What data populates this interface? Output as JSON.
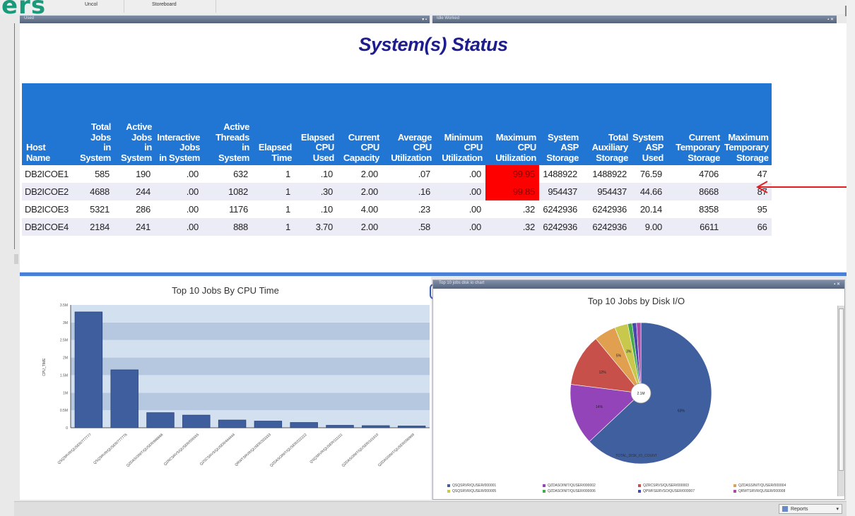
{
  "app": {
    "logo": "ers",
    "tabs": [
      "Uncol",
      "Storeboard"
    ],
    "left_window_title": "Used",
    "right_window_title": "Idle Worked"
  },
  "status": {
    "title": "System(s) Status",
    "columns": [
      "Host Name",
      "Total Jobs in System",
      "Active Jobs in System",
      "Interactive Jobs in System",
      "Active Threads in System",
      "Elapsed Time",
      "Elapsed CPU Used",
      "Current CPU Capacity",
      "Average CPU Utilization",
      "Minimum CPU Utilization",
      "Maximum CPU Utilization",
      "System ASP Storage",
      "Total Auxiliary Storage",
      "System ASP Used",
      "Current Temporary Storage",
      "Maximum Temporary Storage"
    ],
    "rows": [
      [
        "DB2ICOE1",
        "585",
        "190",
        ".00",
        "632",
        "1",
        ".10",
        "2.00",
        ".07",
        ".00",
        "99.95",
        "1488922",
        "1488922",
        "76.59",
        "4706",
        "47"
      ],
      [
        "DB2ICOE2",
        "4688",
        "244",
        ".00",
        "1082",
        "1",
        ".30",
        "2.00",
        ".16",
        ".00",
        "99.85",
        "954437",
        "954437",
        "44.66",
        "8668",
        "87"
      ],
      [
        "DB2ICOE3",
        "5321",
        "286",
        ".00",
        "1176",
        "1",
        ".10",
        "4.00",
        ".23",
        ".00",
        ".32",
        "6242936",
        "6242936",
        "20.14",
        "8358",
        "95"
      ],
      [
        "DB2ICOE4",
        "2184",
        "241",
        ".00",
        "888",
        "1",
        "3.70",
        "2.00",
        ".58",
        ".00",
        ".32",
        "6242936",
        "6242936",
        "9.00",
        "6611",
        "66"
      ]
    ],
    "alert_cells": [
      [
        0,
        10
      ],
      [
        1,
        10
      ]
    ],
    "alert_color": "#ff0000",
    "arrow_color": "#e02020"
  },
  "cpu_chart": {
    "title": "Top 10 Jobs By CPU Time",
    "window_title": "",
    "ylabel": "CPU_TIME"
  },
  "disk_chart": {
    "title": "Top 10 Jobs by Disk I/O",
    "window_title": "Top 10 jobs disk io chart",
    "center_label": "2.1M",
    "x_label": "TOTAL_DISK_IO_COUNT"
  },
  "bottom": {
    "reports": "Reports"
  },
  "chart_data": [
    {
      "type": "bar",
      "title": "Top 10 Jobs By CPU Time",
      "ylabel": "CPU_TIME",
      "categories": [
        "QSQSRVR/QUSER/777777",
        "QSQSRVR/QUSER/777776",
        "QZDASOINIT/QUSER/666666",
        "QZRCSRVS/QUSER/555555",
        "QZSCSRVS/QUSER/444444",
        "QRWTSRVR/QUSER/333333",
        "QZDASOINIT/QUSER/222222",
        "QSQSRVR/QUSER/111111",
        "QZDASOINIT/QUSER/101010",
        "QZDASSINIT/QUSER/090909"
      ],
      "values": [
        3.3,
        1.65,
        0.43,
        0.36,
        0.22,
        0.19,
        0.15,
        0.07,
        0.06,
        0.05
      ],
      "ylim": [
        0,
        3.5
      ],
      "yticks": [
        "0",
        "0.5M",
        "1M",
        "1.5M",
        "2M",
        "2.5M",
        "3M",
        "3.5M"
      ],
      "bar_color": "#3e5e9e",
      "grid": "banded"
    },
    {
      "type": "pie",
      "title": "Top 10 Jobs by Disk I/O",
      "style": "donut",
      "slices": [
        {
          "label": "QSQSRVR/QUSER/000001",
          "value": 63,
          "color": "#3f5f9f",
          "text": "63%"
        },
        {
          "label": "QZDASOINIT/QUSER/000002",
          "value": 14,
          "color": "#9244b8",
          "text": "14%"
        },
        {
          "label": "QZRCSRVS/QUSER/000003",
          "value": 12,
          "color": "#c8504a",
          "text": "12%"
        },
        {
          "label": "QZDASSINIT/QUSER/000004",
          "value": 5,
          "color": "#e0a050",
          "text": "5%"
        },
        {
          "label": "QSQSRVR/QUSER/000005",
          "value": 3,
          "color": "#c8c84c",
          "text": "3%"
        },
        {
          "label": "QZDASOINIT/QUSER/000006",
          "value": 1,
          "color": "#48a84c",
          "text": ""
        },
        {
          "label": "QPWFSERVSO/QUSER/000007",
          "value": 1,
          "color": "#4848a8",
          "text": ""
        },
        {
          "label": "QRWTSRVR/QUSER/000008",
          "value": 1,
          "color": "#a848a8",
          "text": ""
        }
      ]
    }
  ]
}
